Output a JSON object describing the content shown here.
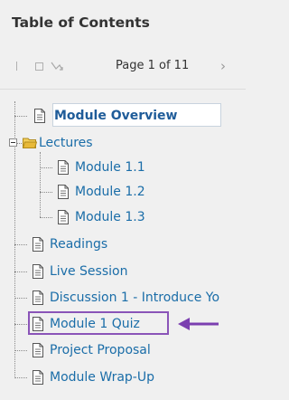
{
  "panel": {
    "title": "Table of Contents"
  },
  "pager": {
    "page_label": "Page 1 of 11",
    "controls": [
      "first-page-icon",
      "checkbox-icon",
      "sync-icon",
      "chevron-right-icon"
    ]
  },
  "tree": {
    "module_overview": {
      "label": "Module Overview",
      "selected": true,
      "icon": "document-icon"
    },
    "lectures": {
      "label": "Lectures",
      "expanded": true,
      "icon": "folder-open-icon",
      "children": [
        {
          "label": "Module 1.1",
          "icon": "document-icon"
        },
        {
          "label": "Module 1.2",
          "icon": "document-icon"
        },
        {
          "label": "Module 1.3",
          "icon": "document-icon"
        }
      ]
    },
    "items": [
      {
        "label": "Readings",
        "icon": "document-icon"
      },
      {
        "label": "Live Session",
        "icon": "document-icon"
      },
      {
        "label": "Discussion 1 - Introduce Yo",
        "icon": "document-icon"
      },
      {
        "label": "Module 1 Quiz",
        "icon": "document-icon",
        "highlighted": true
      },
      {
        "label": "Project Proposal",
        "icon": "document-icon"
      },
      {
        "label": "Module Wrap-Up",
        "icon": "document-icon"
      }
    ]
  },
  "colors": {
    "link": "#1a6da8",
    "highlight_box": "#8a54b8",
    "arrow": "#7b3fb0",
    "folder": "#e8b938"
  }
}
